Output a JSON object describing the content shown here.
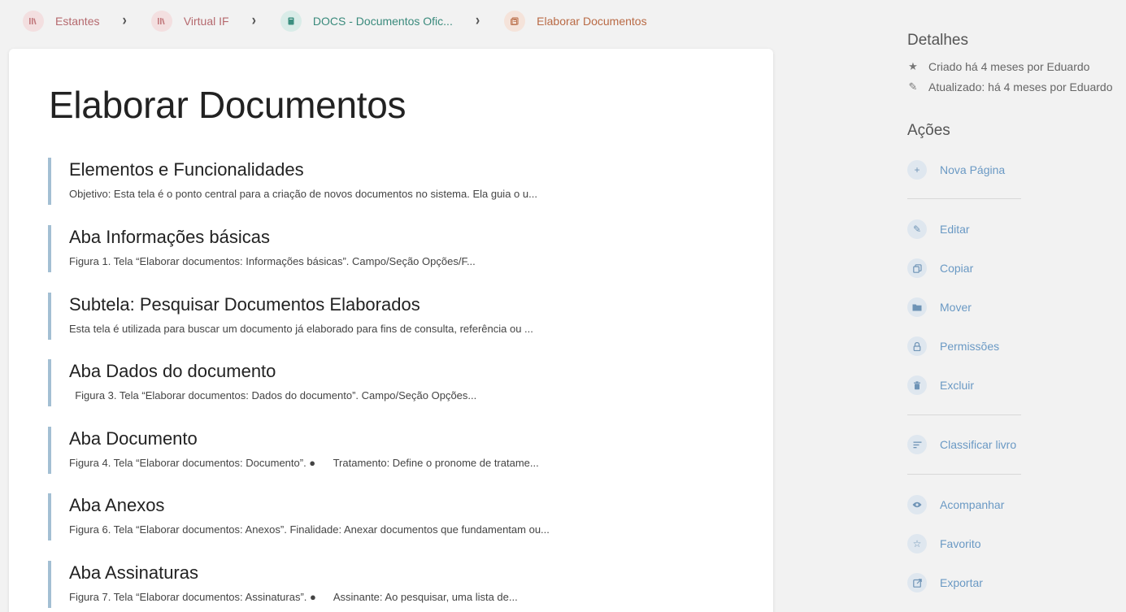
{
  "breadcrumb": {
    "items": [
      {
        "label": "Estantes",
        "icon": "shelves-icon"
      },
      {
        "label": "Virtual IF",
        "icon": "shelf-icon"
      },
      {
        "label": "DOCS - Documentos Ofic...",
        "icon": "book-icon"
      },
      {
        "label": "Elaborar Documentos",
        "icon": "chapter-icon"
      }
    ]
  },
  "main": {
    "title": "Elaborar Documentos",
    "entries": [
      {
        "title": "Elementos e Funcionalidades",
        "excerpt": "Objetivo: Esta tela é o ponto central para a criação de novos documentos no sistema. Ela guia o u..."
      },
      {
        "title": "Aba Informações básicas",
        "excerpt": "Figura 1. Tela “Elaborar documentos: Informações básicas”. Campo/Seção Opções/F..."
      },
      {
        "title": "Subtela: Pesquisar Documentos Elaborados",
        "excerpt": "Esta tela é utilizada para buscar um documento já elaborado para fins de consulta, referência ou ..."
      },
      {
        "title": "Aba Dados do documento",
        "excerpt": "  Figura 3. Tela “Elaborar documentos: Dados do documento”. Campo/Seção Opções..."
      },
      {
        "title": "Aba Documento",
        "excerpt": "Figura 4. Tela “Elaborar documentos: Documento”. ●      Tratamento: Define o pronome de tratame..."
      },
      {
        "title": "Aba Anexos",
        "excerpt": "Figura 6. Tela “Elaborar documentos: Anexos”. Finalidade: Anexar documentos que fundamentam ou..."
      },
      {
        "title": "Aba Assinaturas",
        "excerpt": "Figura 7. Tela “Elaborar documentos: Assinaturas”. ●      Assinante: Ao pesquisar, uma lista de..."
      }
    ]
  },
  "sidebar": {
    "details_heading": "Detalhes",
    "created": "Criado há 4 meses por Eduardo",
    "updated": "Atualizado: há 4 meses por Eduardo",
    "actions_heading": "Ações",
    "actions": {
      "new_page": "Nova Página",
      "edit": "Editar",
      "copy": "Copiar",
      "move": "Mover",
      "permissions": "Permissões",
      "delete": "Excluir",
      "sort_book": "Classificar livro",
      "watch": "Acompanhar",
      "favorite": "Favorito",
      "export": "Exportar"
    }
  },
  "colors": {
    "shelf_accent": "#b5696e",
    "book_accent": "#3a8a7c",
    "chapter_accent": "#b96a45",
    "link": "#6a99c4",
    "entry_border": "#a3bfd3"
  }
}
